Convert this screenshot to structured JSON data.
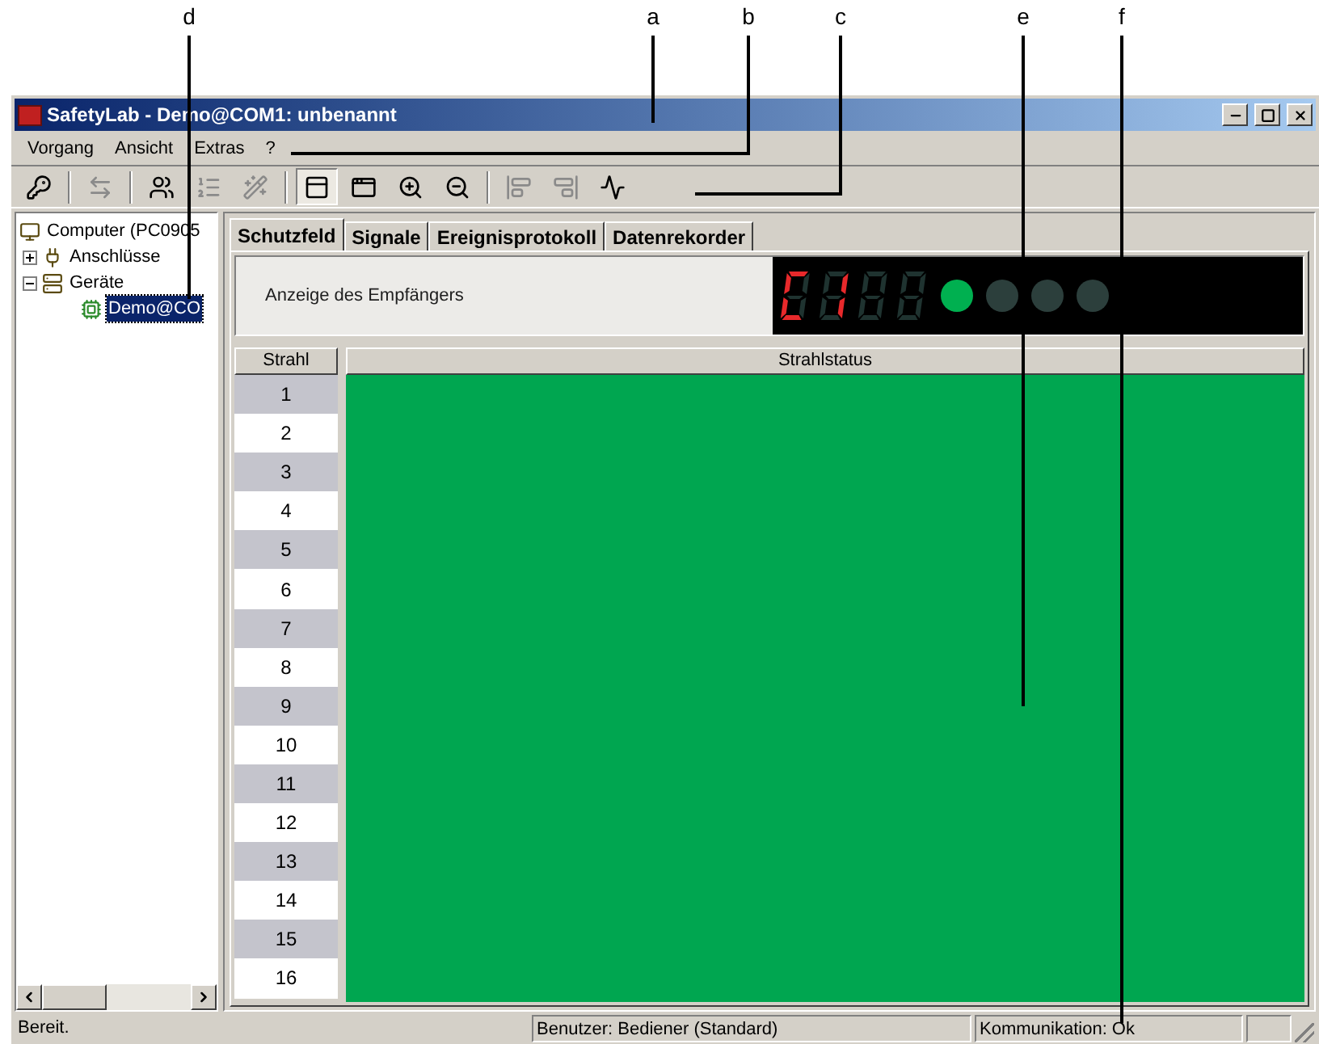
{
  "callouts": [
    {
      "label": "d"
    },
    {
      "label": "a"
    },
    {
      "label": "b"
    },
    {
      "label": "c"
    },
    {
      "label": "e"
    },
    {
      "label": "f"
    }
  ],
  "window": {
    "title": "SafetyLab - Demo@COM1: unbenannt"
  },
  "menu": [
    {
      "label": "Vorgang"
    },
    {
      "label": "Ansicht"
    },
    {
      "label": "Extras"
    },
    {
      "label": "?"
    }
  ],
  "toolbar": [
    {
      "kind": "button",
      "disabled": false,
      "pressed": false
    },
    {
      "kind": "separator"
    },
    {
      "kind": "button",
      "disabled": true,
      "pressed": false
    },
    {
      "kind": "separator"
    },
    {
      "kind": "button",
      "disabled": false,
      "pressed": false
    },
    {
      "kind": "button",
      "disabled": true,
      "pressed": false
    },
    {
      "kind": "button",
      "disabled": true,
      "pressed": false
    },
    {
      "kind": "separator"
    },
    {
      "kind": "button",
      "disabled": false,
      "pressed": true
    },
    {
      "kind": "button",
      "disabled": false,
      "pressed": false
    },
    {
      "kind": "button",
      "disabled": false,
      "pressed": false
    },
    {
      "kind": "button",
      "disabled": false,
      "pressed": false
    },
    {
      "kind": "separator"
    },
    {
      "kind": "button",
      "disabled": true,
      "pressed": false
    },
    {
      "kind": "button",
      "disabled": true,
      "pressed": false
    },
    {
      "kind": "button",
      "disabled": false,
      "pressed": false
    }
  ],
  "tree": [
    {
      "label": "Computer (PC0905",
      "selected": false,
      "children": [
        {
          "label": "Anschlüsse",
          "expanded": false,
          "selected": false
        },
        {
          "label": "Geräte",
          "expanded": true,
          "selected": false,
          "children": [
            {
              "label": "Demo@CO",
              "selected": true
            }
          ]
        }
      ]
    }
  ],
  "tabs": [
    {
      "label": "Schutzfeld",
      "selected": true
    },
    {
      "label": "Signale",
      "selected": false
    },
    {
      "label": "Ereignisprotokoll",
      "selected": false
    },
    {
      "label": "Datenrekorder",
      "selected": false
    }
  ],
  "receiver": {
    "label": "Anzeige des Empfängers",
    "lamps": [
      {
        "on": true
      },
      {
        "on": false
      },
      {
        "on": false
      },
      {
        "on": false
      }
    ]
  },
  "table": {
    "columns": [
      "Strahl",
      "Strahlstatus"
    ],
    "rows": [
      "1",
      "2",
      "3",
      "4",
      "5",
      "6",
      "7",
      "8",
      "9",
      "10",
      "11",
      "12",
      "13",
      "14",
      "15",
      "16"
    ]
  },
  "status_bar": [
    "Bereit.",
    "Benutzer: Bediener (Standard)",
    "Kommunikation: Ok"
  ]
}
